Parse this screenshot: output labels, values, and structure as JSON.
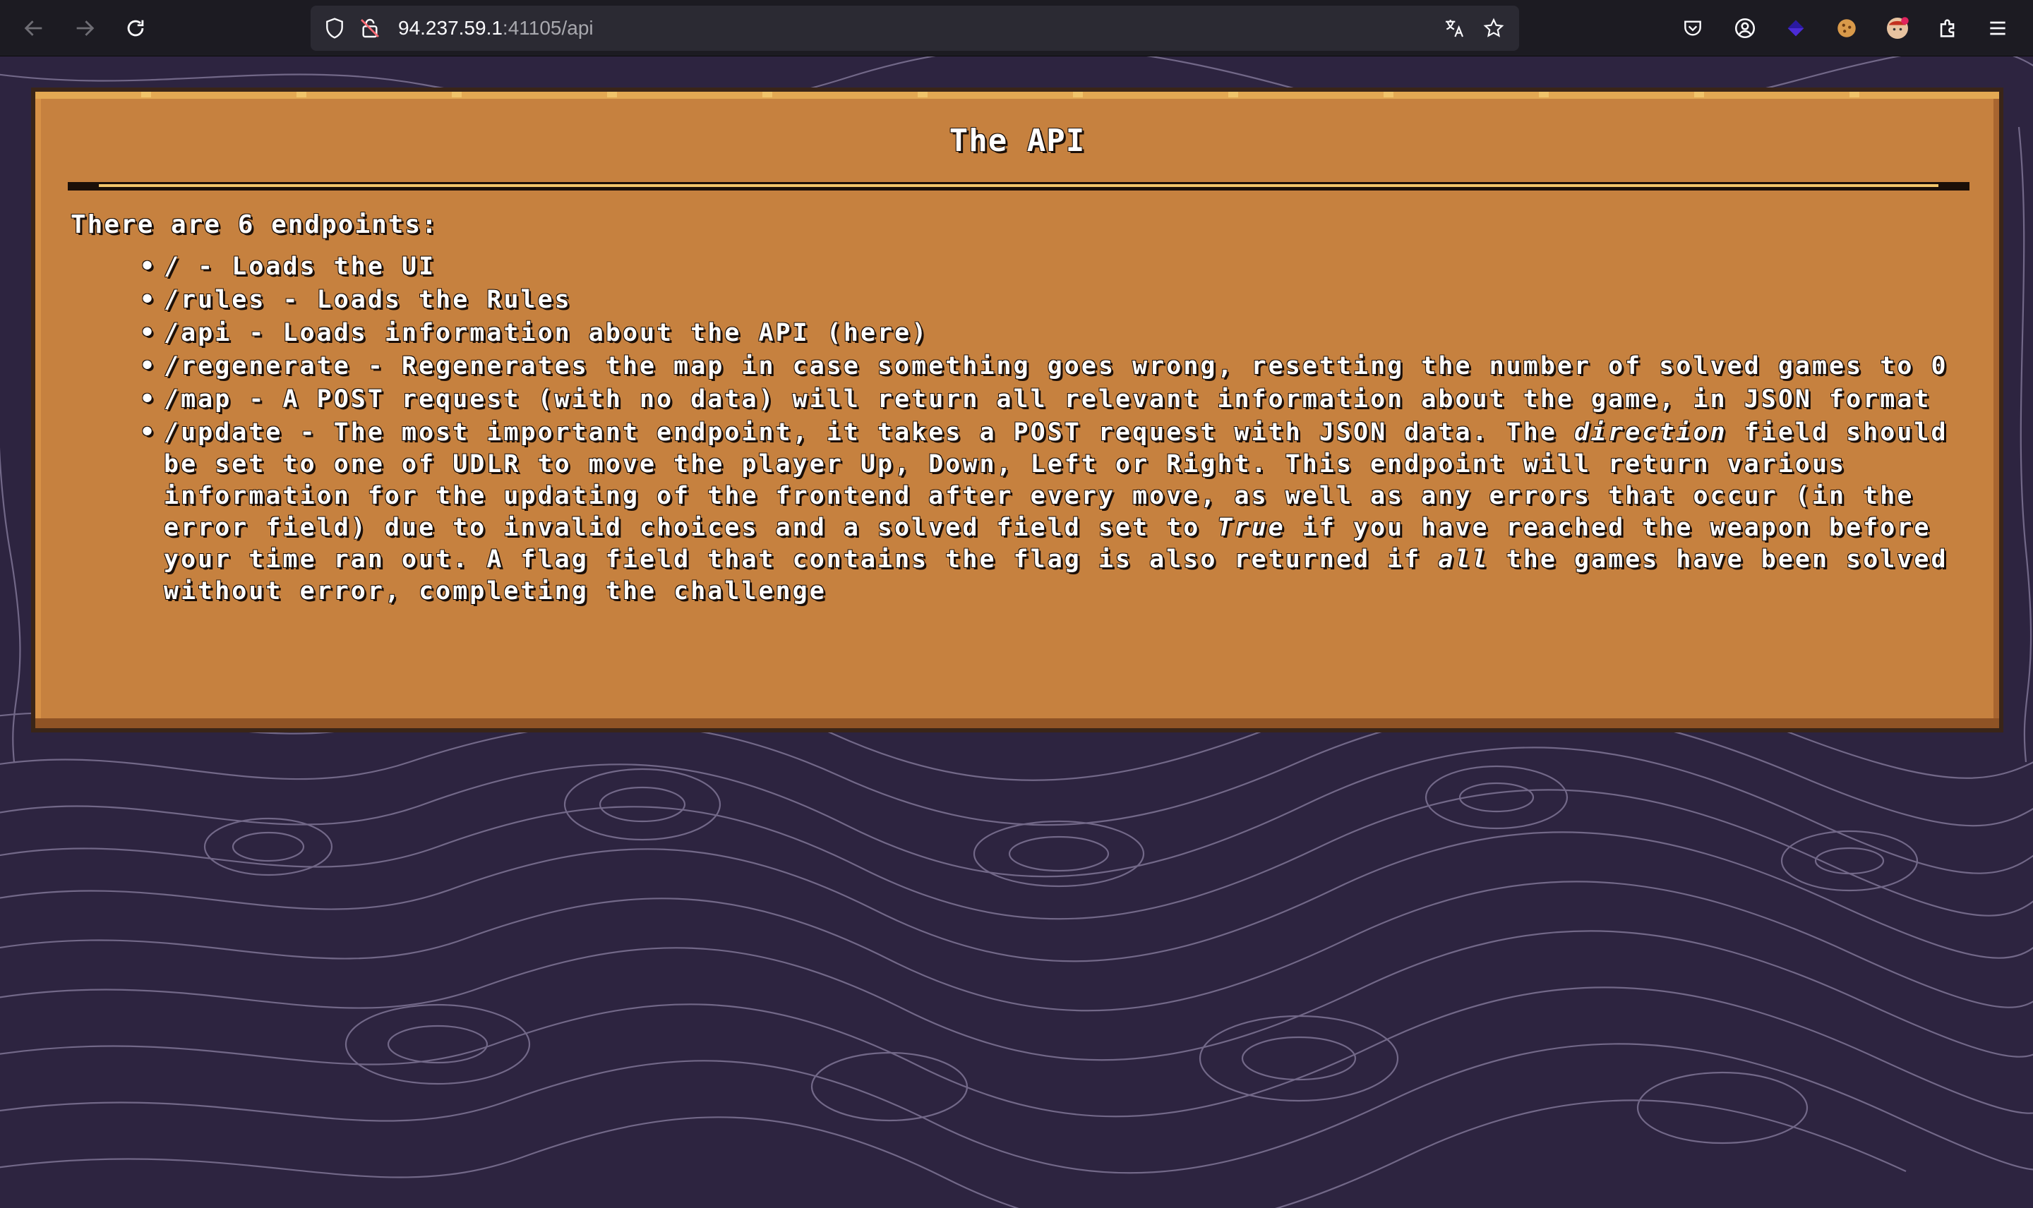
{
  "browser": {
    "url_host": "94.237.59.1",
    "url_rest": ":41105/api",
    "back_icon": "arrow-left-icon",
    "forward_icon": "arrow-right-icon",
    "reload_icon": "reload-icon"
  },
  "panel": {
    "title": "The API",
    "intro": "There are 6 endpoints:",
    "endpoints": [
      {
        "path": "/",
        "text": " - Loads the UI"
      },
      {
        "path": "/rules",
        "text": " - Loads the Rules"
      },
      {
        "path": "/api",
        "text": " - Loads information about the API (here)"
      },
      {
        "path": "/regenerate",
        "text": " - Regenerates the map in case something goes wrong, resetting the number of solved games to 0"
      },
      {
        "path": "/map",
        "text": " - A POST request (with no data) will return all relevant information about the game, in JSON format"
      },
      {
        "path": "/update",
        "text_a": " - The most important endpoint, it takes a POST request with JSON data. The ",
        "em_a": "direction",
        "text_b": " field should be set to one of UDLR to move the player Up, Down, Left or Right. This endpoint will return various information for the updating of the frontend after every move, as well as any errors that occur (in the error field) due to invalid choices and a solved field set to ",
        "em_b": "True",
        "text_c": " if you have reached the weapon before your time ran out. A flag field that contains the flag is also returned if ",
        "em_c": "all",
        "text_d": " the games have been solved without error, completing the challenge"
      }
    ]
  },
  "colors": {
    "background": "#2d2440",
    "panel": "#c6813f",
    "contour": "#8a7fa0"
  }
}
